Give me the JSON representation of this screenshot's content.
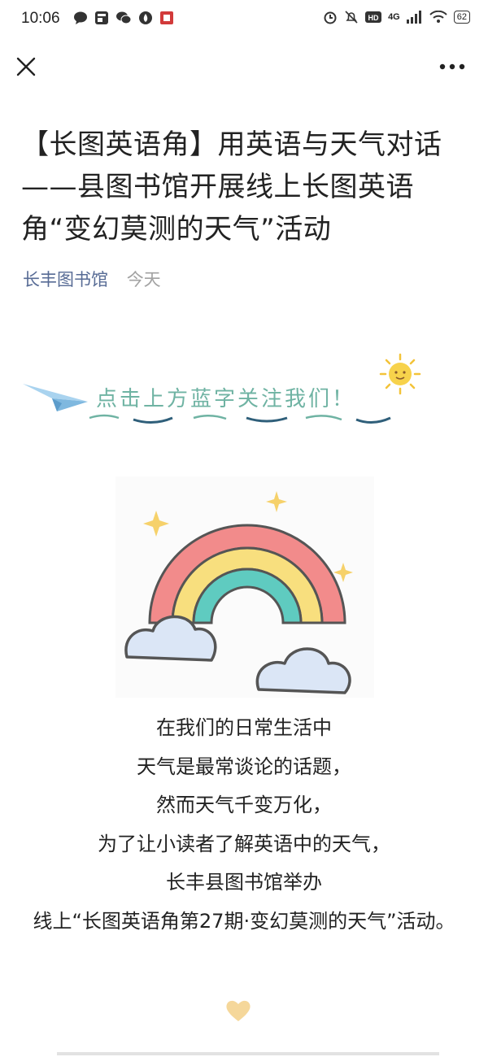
{
  "status_bar": {
    "time": "10:06",
    "network": "4G",
    "battery": "62"
  },
  "toolbar": {
    "close_icon": "close-icon",
    "more_icon": "more-icon"
  },
  "article": {
    "title": "【长图英语角】用英语与天气对话 ——县图书馆开展线上长图英语角“变幻莫测的天气”活动",
    "author": "长丰图书馆",
    "date": "今天",
    "follow_prompt": "点击上方蓝字关注我们！",
    "body_lines": [
      "在我们的日常生活中",
      "天气是最常谈论的话题，",
      "然而天气千变万化，",
      "为了让小读者了解英语中的天气，",
      "长丰县图书馆举办",
      "线上“长图英语角第27期·变幻莫测的天气”活动。"
    ]
  },
  "colors": {
    "author": "#576b95",
    "follow_text": "#6fb3a3",
    "heart": "#f5d79a"
  }
}
